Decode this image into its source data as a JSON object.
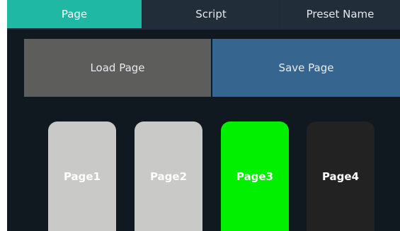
{
  "tabs": [
    {
      "label": "Page",
      "active": true
    },
    {
      "label": "Script",
      "active": false
    },
    {
      "label": "Preset Name",
      "active": false
    }
  ],
  "actions": {
    "load_label": "Load Page",
    "save_label": "Save Page"
  },
  "pages": [
    {
      "label": "Page1",
      "color": "#c9c9c7"
    },
    {
      "label": "Page2",
      "color": "#c9c9c7"
    },
    {
      "label": "Page3",
      "color": "#00f000",
      "selected": true
    },
    {
      "label": "Page4",
      "color": "#222222"
    }
  ],
  "colors": {
    "panel_bg": "#101820",
    "tab_active": "#1fb8a5",
    "load_button": "#5d5d5b",
    "save_button": "#36668f"
  }
}
